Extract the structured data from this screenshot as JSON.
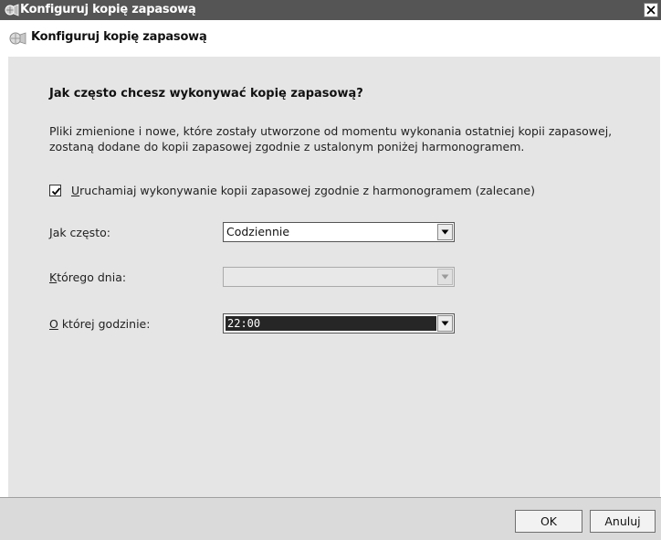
{
  "window": {
    "title": "Konfiguruj kopię zapasową",
    "close_label": "×"
  },
  "nav": {
    "title": "Konfiguruj kopię zapasową"
  },
  "main": {
    "heading": "Jak często chcesz wykonywać kopię zapasową?",
    "description_line1": "Pliki zmienione i nowe, które zostały utworzone od momentu wykonania ostatniej kopii zapasowej,",
    "description_line2": "zostaną dodane do kopii zapasowej zgodnie z ustalonym poniżej harmonogramem.",
    "schedule_checkbox": {
      "checked": true,
      "label_first": "U",
      "label_rest": "ruchamiaj wykonywanie kopii zapasowej zgodnie z harmonogramem (zalecane)"
    },
    "how_often": {
      "label_first": "J",
      "label_rest": "ak często:",
      "value": "Codziennie"
    },
    "which_day": {
      "label_first": "K",
      "label_rest": "tórego dnia:",
      "value": "",
      "disabled": true
    },
    "what_time": {
      "label_first": "O",
      "label_rest": " której godzinie:",
      "value": "22:00"
    }
  },
  "footer": {
    "ok_label": "OK",
    "cancel_label": "Anuluj"
  }
}
